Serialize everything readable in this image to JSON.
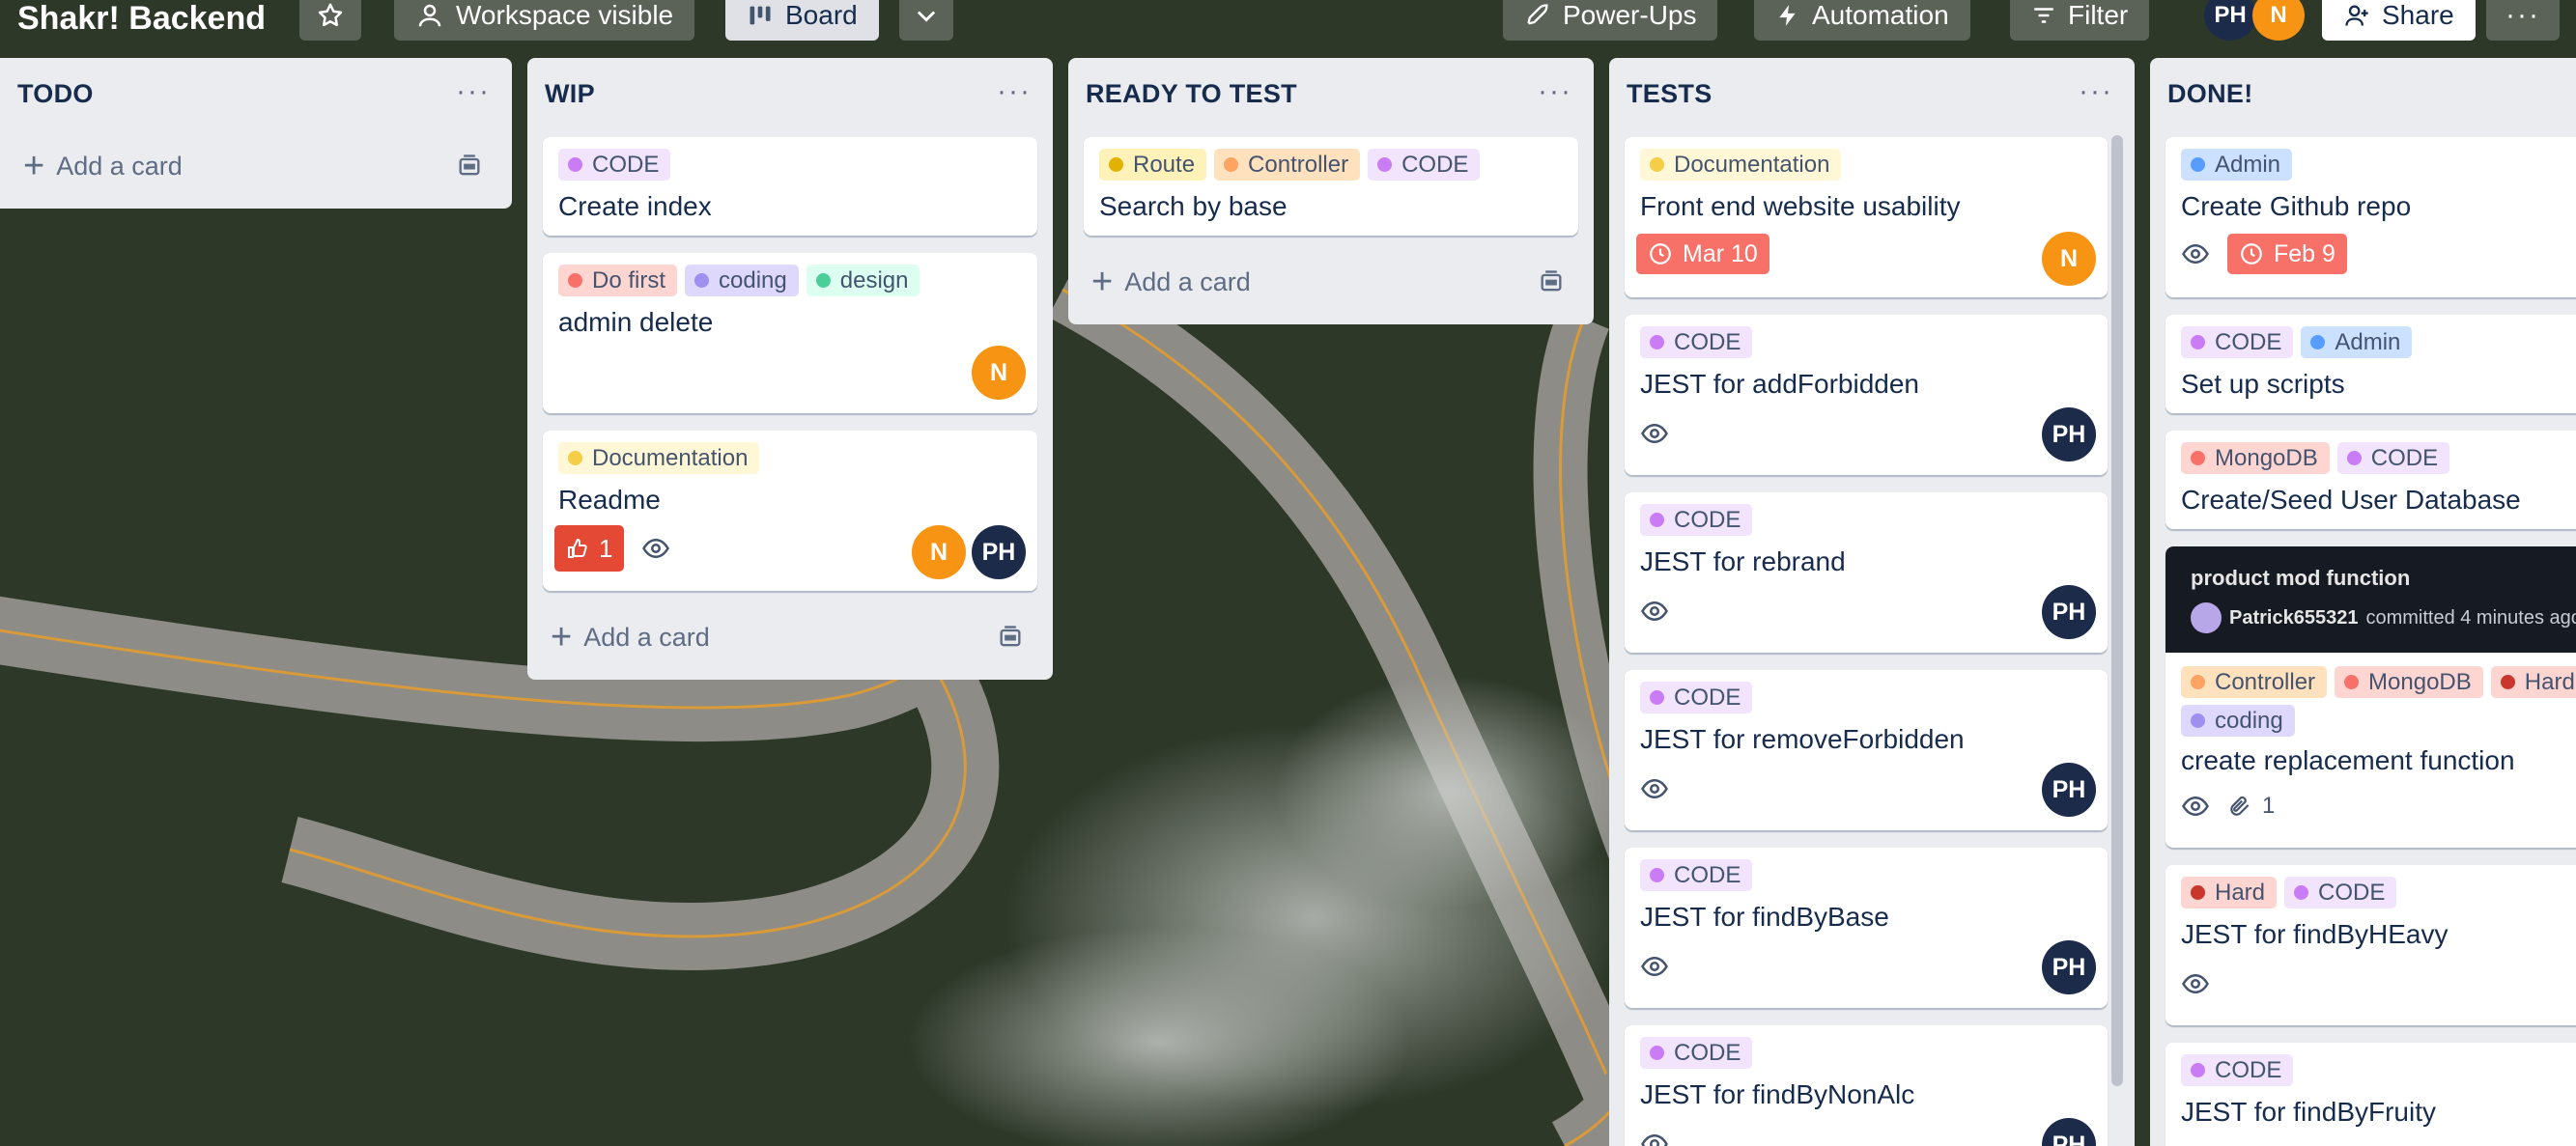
{
  "board": {
    "name": "Shakr! Backend",
    "visibility_label": "Workspace visible",
    "view_label": "Board",
    "powerups_label": "Power-Ups",
    "automation_label": "Automation",
    "filter_label": "Filter",
    "share_label": "Share",
    "members": [
      "PH",
      "N"
    ]
  },
  "colors": {
    "code": "#9f8fef",
    "code_bg": "#f1e4fc",
    "doc": "#f5cd47",
    "doc_bg": "#fff7d6",
    "route": "#e2b203",
    "route_bg": "#fff2b8",
    "controller": "#fea362",
    "controller_bg": "#ffe2bd",
    "red": "#f87168",
    "red_bg": "#ffd5d2",
    "coding": "#9f8fef",
    "coding_bg": "#dfd8fd",
    "design": "#4bce97",
    "design_bg": "#dcfff1",
    "admin": "#579dff",
    "admin_bg": "#cce0ff"
  },
  "lists": {
    "todo": {
      "title": "TODO",
      "add_label": "Add a card"
    },
    "wip": {
      "title": "WIP",
      "add_label": "Add a card",
      "cards": [
        {
          "labels": [
            "CODE"
          ],
          "title": "Create index"
        },
        {
          "labels": [
            "Do first",
            "coding",
            "design"
          ],
          "title": "admin delete",
          "members": [
            "N"
          ]
        },
        {
          "labels": [
            "Documentation"
          ],
          "title": "Readme",
          "votes": "1",
          "members": [
            "N",
            "PH"
          ]
        }
      ]
    },
    "ready": {
      "title": "READY TO TEST",
      "add_label": "Add a card",
      "cards": [
        {
          "labels": [
            "Route",
            "Controller",
            "CODE"
          ],
          "title": "Search by base"
        }
      ]
    },
    "tests": {
      "title": "TESTS",
      "cards": [
        {
          "labels": [
            "Documentation"
          ],
          "title": "Front end website usability",
          "due": "Mar 10",
          "members": [
            "N"
          ]
        },
        {
          "labels": [
            "CODE"
          ],
          "title": "JEST for addForbidden",
          "members": [
            "PH"
          ]
        },
        {
          "labels": [
            "CODE"
          ],
          "title": "JEST for rebrand",
          "members": [
            "PH"
          ]
        },
        {
          "labels": [
            "CODE"
          ],
          "title": "JEST for removeForbidden",
          "members": [
            "PH"
          ]
        },
        {
          "labels": [
            "CODE"
          ],
          "title": "JEST for findByBase",
          "members": [
            "PH"
          ]
        },
        {
          "labels": [
            "CODE"
          ],
          "title": "JEST for findByNonAlc",
          "members": [
            "PH"
          ]
        }
      ]
    },
    "done": {
      "title": "DONE!",
      "cards": [
        {
          "labels": [
            "Admin"
          ],
          "title": "Create Github repo",
          "due": "Feb 9"
        },
        {
          "labels": [
            "CODE",
            "Admin"
          ],
          "title": "Set up scripts"
        },
        {
          "labels": [
            "MongoDB",
            "CODE"
          ],
          "title": "Create/Seed User Database"
        },
        {
          "commit_title": "product mod function",
          "commit_user": "Patrick655321",
          "commit_text": "committed 4 minutes ago",
          "labels": [
            "Controller",
            "MongoDB",
            "Hard",
            "coding"
          ],
          "title": "create replacement function",
          "attachments": "1"
        },
        {
          "labels": [
            "Hard",
            "CODE"
          ],
          "title": "JEST for findByHEavy"
        },
        {
          "labels": [
            "CODE"
          ],
          "title": "JEST for findByFruity"
        }
      ]
    }
  },
  "icons": [
    "star-icon",
    "people-icon",
    "board-icon",
    "chevron-down-icon",
    "rocket-icon",
    "bolt-icon",
    "filter-icon",
    "add-person-icon",
    "ellipsis-icon",
    "eye-icon",
    "clock-icon",
    "thumbs-up-icon",
    "paperclip-icon",
    "template-icon",
    "plus-icon"
  ]
}
